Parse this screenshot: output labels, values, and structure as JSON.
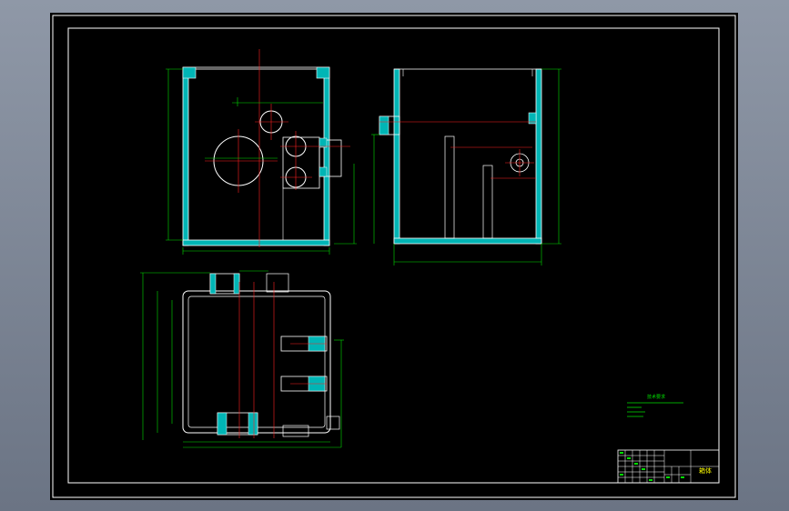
{
  "drawing": {
    "background": "#000000",
    "border_color": "#ffffff",
    "outline_color": "#ffffff",
    "wall_hatch_color": "#00c8c8",
    "dimension_color": "#00ff00",
    "centerline_color": "#ff0000"
  },
  "views": {
    "front": {
      "label": ""
    },
    "side": {
      "label": ""
    },
    "top": {
      "label": ""
    }
  },
  "notes": {
    "title": "技术要求",
    "lines": [
      "",
      "",
      ""
    ]
  },
  "title_block": {
    "part_name": "箱体"
  }
}
